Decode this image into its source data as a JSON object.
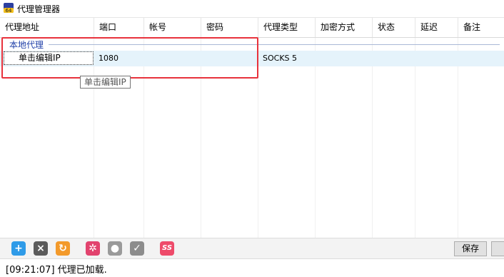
{
  "window": {
    "title": "代理管理器",
    "app_icon": "proxy-app-icon"
  },
  "columns": [
    "代理地址",
    "端口",
    "帐号",
    "密码",
    "代理类型",
    "加密方式",
    "状态",
    "延迟",
    "备注"
  ],
  "group": {
    "label": "本地代理"
  },
  "row": {
    "address": "单击编辑IP",
    "port": "1080",
    "account": "",
    "password": "",
    "type": "SOCKS 5",
    "encryption": "",
    "status": "",
    "latency": "",
    "note": ""
  },
  "tooltip": "单击编辑IP",
  "toolbar": {
    "buttons": [
      {
        "icon": "add-icon",
        "color": "#2f9be8"
      },
      {
        "icon": "delete-icon",
        "color": "#5b5b5b"
      },
      {
        "icon": "refresh-icon",
        "color": "#f39a2b"
      },
      {
        "icon": "settings-icon",
        "color": "#e2436e"
      },
      {
        "icon": "lightbulb-icon",
        "color": "#9a9a9a"
      },
      {
        "icon": "check-icon",
        "color": "#8c8c8c"
      },
      {
        "icon": "ss-icon",
        "color": "#ee4b6a"
      }
    ],
    "ss_label": "SS",
    "save_label": "保存"
  },
  "status": {
    "text": "[09:21:07]  代理已加载."
  },
  "colors": {
    "highlight": "#e8323c",
    "group_text": "#1f3fa8",
    "selected_row": "#e5f3fb"
  }
}
